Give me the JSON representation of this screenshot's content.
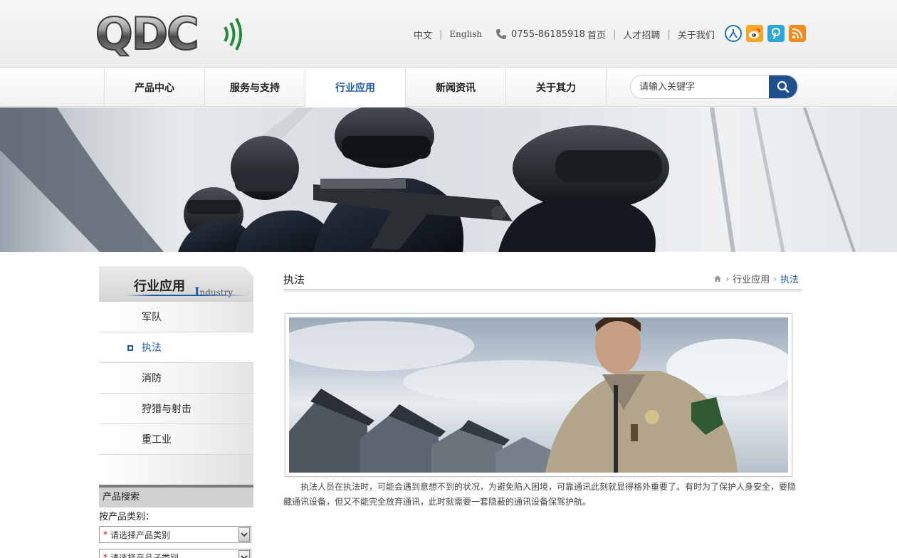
{
  "header": {
    "logo_text": "QDC",
    "lang_cn": "中文",
    "lang_en": "English",
    "phone": "0755-86185918",
    "links": [
      "首页",
      "人才招聘",
      "关于我们"
    ],
    "social_icons": [
      "renren-icon",
      "weibo-icon",
      "pinterest-icon",
      "rss-icon"
    ],
    "social_colors": [
      "#1e6fc1",
      "#f5a623",
      "#2aa7d9",
      "#f28a1e"
    ]
  },
  "nav": {
    "items": [
      "产品中心",
      "服务与支持",
      "行业应用",
      "新闻资讯",
      "关于其力"
    ],
    "active_index": 2,
    "search_placeholder": "请输入关键字"
  },
  "sidebar": {
    "title_cn": "行业应用",
    "title_en_cap": "I",
    "title_en_rest": "ndustry",
    "items": [
      "军队",
      "执法",
      "消防",
      "狩猎与射击",
      "重工业"
    ],
    "active_index": 1
  },
  "product_search": {
    "heading": "产品搜索",
    "by_category_label": "按产品类别：",
    "select1": "请选择产品类别",
    "select2": "请选择产品子类别"
  },
  "main": {
    "title": "执法",
    "breadcrumb": [
      "行业应用",
      "执法"
    ],
    "description": "执法人员在执法时，可能会遇到意想不到的状况，为避免陷入困境，可靠通讯此刻就显得格外重要了。有时为了保护人身安全，要隐藏通讯设备，但又不能完全放弃通讯，此时就需要一套隐蔽的通讯设备保驾护航。"
  },
  "colors": {
    "accent": "#1d5aa6",
    "search_button": "#1f4f8c"
  }
}
